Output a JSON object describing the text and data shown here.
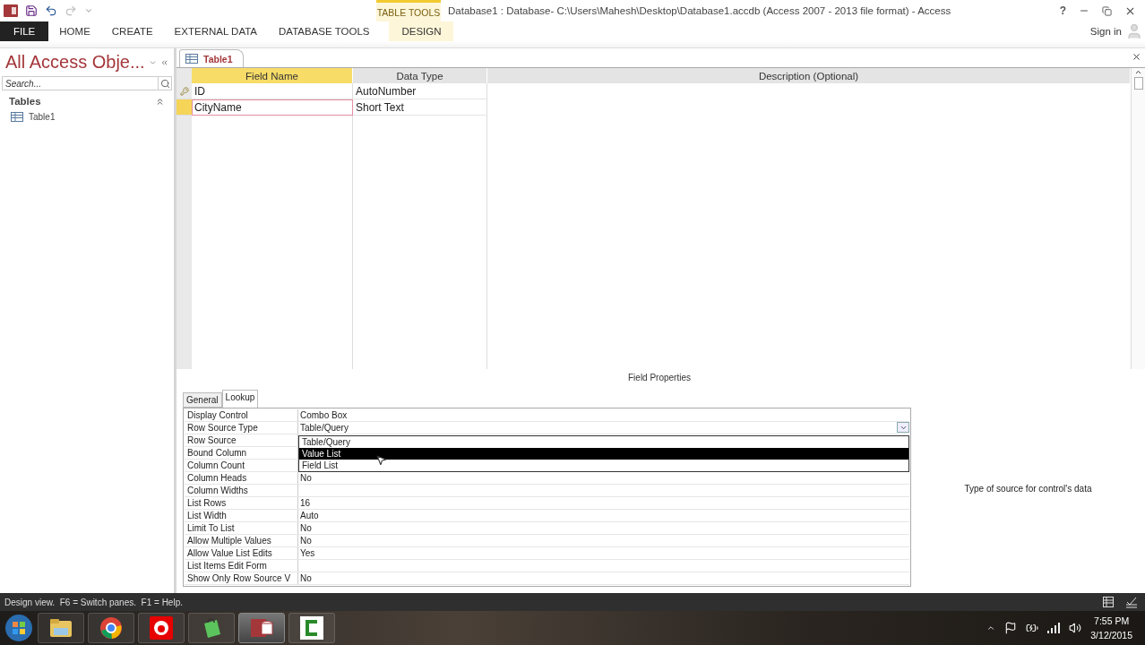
{
  "title_bar": {
    "contextual_label": "TABLE TOOLS",
    "title": "Database1 : Database- C:\\Users\\Mahesh\\Desktop\\Database1.accdb (Access 2007 - 2013 file format) - Access",
    "help": "?"
  },
  "ribbon_tabs": [
    {
      "label": "FILE",
      "kind": "file"
    },
    {
      "label": "HOME",
      "kind": "normal"
    },
    {
      "label": "CREATE",
      "kind": "normal"
    },
    {
      "label": "EXTERNAL DATA",
      "kind": "normal"
    },
    {
      "label": "DATABASE TOOLS",
      "kind": "normal"
    },
    {
      "label": "DESIGN",
      "kind": "contextual"
    }
  ],
  "sign_in": "Sign in",
  "nav_pane": {
    "title": "All Access Obje...",
    "search": {
      "placeholder": "Search..."
    },
    "groups": [
      {
        "label": "Tables",
        "expanded": true,
        "items": [
          "Table1"
        ]
      }
    ]
  },
  "document_tab": "Table1",
  "design_grid": {
    "columns": [
      "Field Name",
      "Data Type",
      "Description (Optional)"
    ],
    "rows": [
      {
        "field_name": "ID",
        "data_type": "AutoNumber",
        "primary_key": true,
        "selected": false
      },
      {
        "field_name": "CityName",
        "data_type": "Short Text",
        "primary_key": false,
        "selected": true
      }
    ]
  },
  "field_properties": {
    "heading": "Field Properties",
    "tabs": [
      {
        "label": "General",
        "selected": false
      },
      {
        "label": "Lookup",
        "selected": true
      }
    ],
    "properties": [
      {
        "name": "Display Control",
        "value": "Combo Box"
      },
      {
        "name": "Row Source Type",
        "value": "Table/Query",
        "kind": "combo"
      },
      {
        "name": "Row Source"
      },
      {
        "name": "Bound Column"
      },
      {
        "name": "Column Count"
      },
      {
        "name": "Column Heads",
        "value": "No"
      },
      {
        "name": "Column Widths"
      },
      {
        "name": "List Rows",
        "value": "16"
      },
      {
        "name": "List Width",
        "value": "Auto"
      },
      {
        "name": "Limit To List",
        "value": "No"
      },
      {
        "name": "Allow Multiple Values",
        "value": "No"
      },
      {
        "name": "Allow Value List Edits",
        "value": "Yes"
      },
      {
        "name": "List Items Edit Form"
      },
      {
        "name": "Show Only Row Source V",
        "value": "No"
      }
    ],
    "dropdown": [
      {
        "label": "Table/Query",
        "selected": false
      },
      {
        "label": "Value List",
        "selected": true
      },
      {
        "label": "Field List",
        "selected": false
      }
    ],
    "help": "Type of source for control's data"
  },
  "status_bar": "Design view.  F6 = Switch panes.  F1 = Help.",
  "taskbar": {
    "time": "7:55 PM",
    "date": "3/12/2015"
  }
}
